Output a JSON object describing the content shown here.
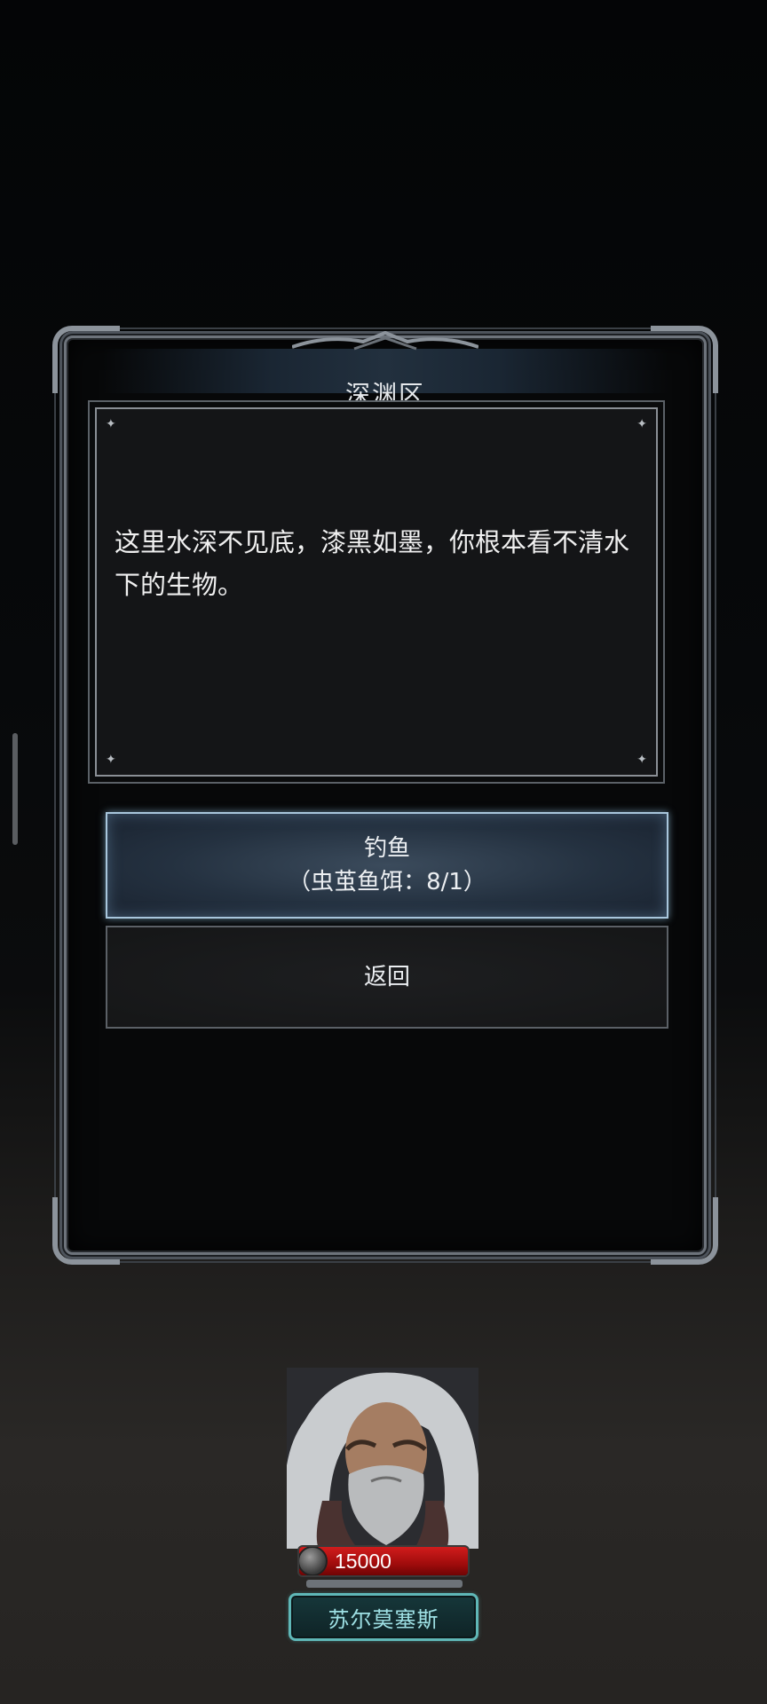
{
  "dialog": {
    "title": "深渊区",
    "description": "这里水深不见底，漆黑如墨，你根本看不清水下的生物。",
    "buttons": {
      "fish_label": "钓鱼",
      "fish_detail": "（虫茧鱼饵：8/1）",
      "back_label": "返回"
    }
  },
  "character": {
    "hp": "15000",
    "name": "苏尔莫塞斯",
    "hp_icon": "hp-orb-icon"
  },
  "colors": {
    "fish_button_border": "#a8c6dc",
    "hp_bar": "#c41414",
    "name_plate_border": "#5fb7b7",
    "name_text": "#9ee0e4"
  }
}
